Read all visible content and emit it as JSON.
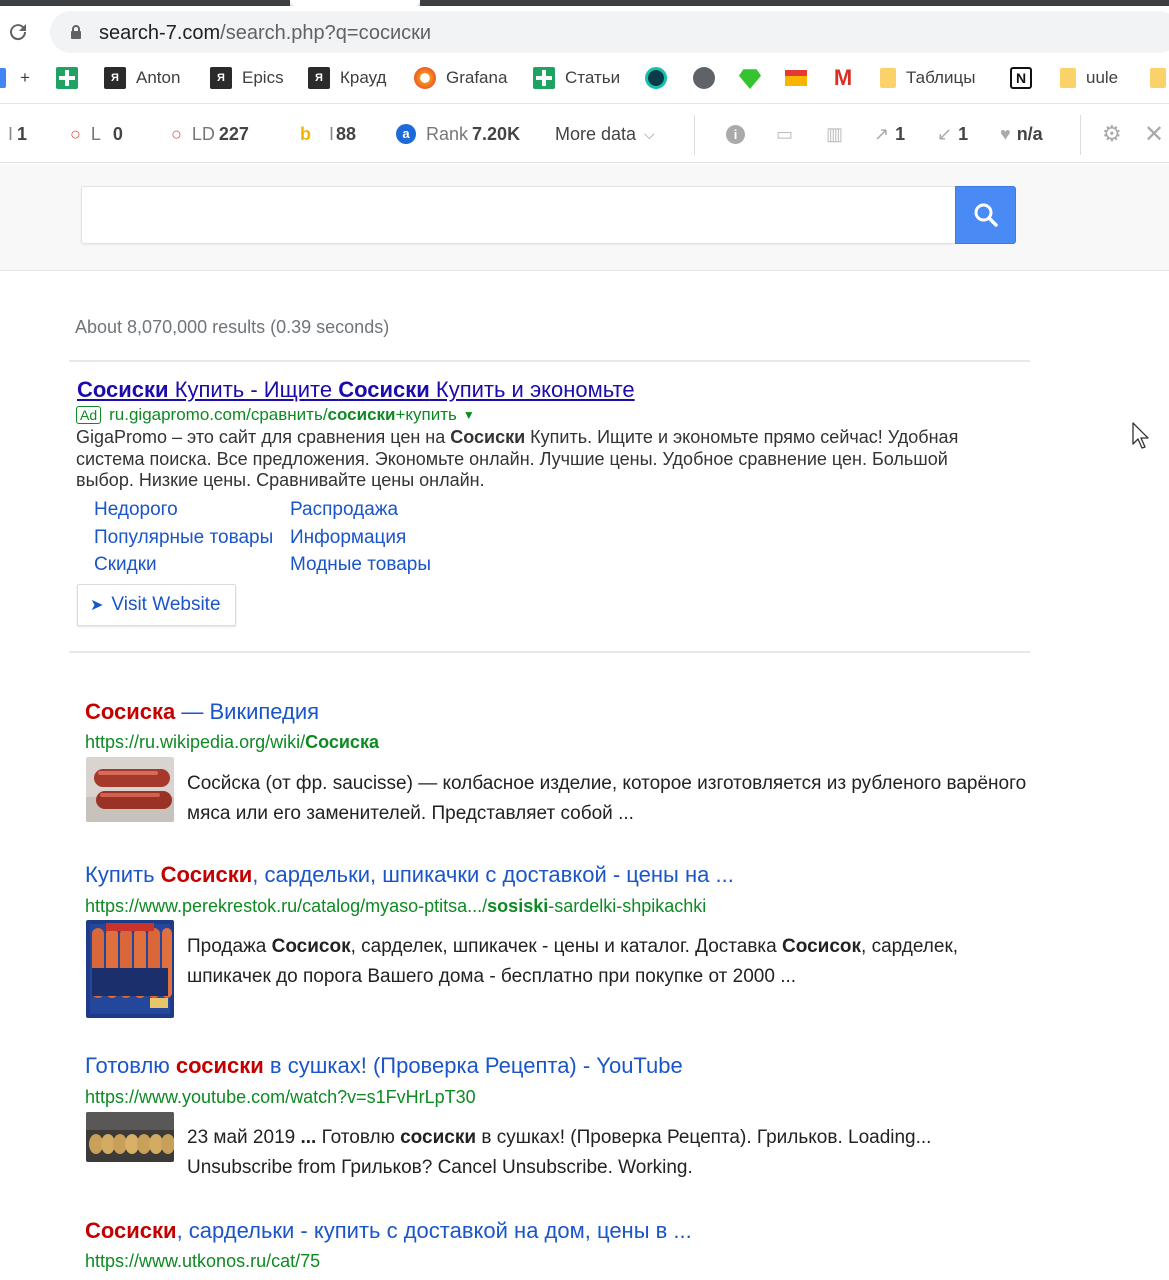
{
  "browser": {
    "url_host": "search-7.com",
    "url_path": "/search.php?q=сосиски"
  },
  "bookmarks": [
    {
      "icon": "plus-icon",
      "label": "+"
    },
    {
      "icon": "google-sheets-icon",
      "label": ""
    },
    {
      "icon": "yandex-ya-icon",
      "label": "Anton"
    },
    {
      "icon": "yandex-ya-icon",
      "label": "Epics"
    },
    {
      "icon": "yandex-ya-icon",
      "label": "Крауд"
    },
    {
      "icon": "grafana-icon",
      "label": "Grafana"
    },
    {
      "icon": "google-sheets-icon",
      "label": "Статьи"
    },
    {
      "icon": "globe-icon",
      "label": ""
    },
    {
      "icon": "sketch-gem-icon",
      "label": ""
    },
    {
      "icon": "mail-icon",
      "label": ""
    },
    {
      "icon": "gmail-icon",
      "label": ""
    },
    {
      "icon": "folder-icon",
      "label": "Таблицы"
    },
    {
      "icon": "notion-icon",
      "label": ""
    },
    {
      "icon": "folder-icon",
      "label": "uule"
    }
  ],
  "seo_bar": {
    "index": "1",
    "links_label": "L",
    "links_value": "0",
    "ld_label": "LD",
    "ld_value": "227",
    "bing_value": "88",
    "rank_label": "Rank",
    "rank_value": "7.20K",
    "more_data": "More data",
    "external_links": "1",
    "internal_links": "1",
    "health": "n/a"
  },
  "search": {
    "query_value": "",
    "stats": "About 8,070,000 results (0.39 seconds)"
  },
  "ad": {
    "title_hl1": "Сосиски",
    "title_mid1": " Купить - Ищите ",
    "title_hl2": "Сосиски",
    "title_mid2": " Купить и экономьте",
    "badge": "Ad",
    "url_pre": "ru.gigapromo.com/сравнить/",
    "url_hl": "сосиски",
    "url_post": "+купить",
    "desc_pre": "GigaPromo – это сайт для сравнения цен на ",
    "desc_hl": "Сосиски",
    "desc_post": " Купить. Ищите и экономьте прямо сейчас! Удобная система поиска. Все предложения. Экономьте онлайн. Лучшие цены. Удобное сравнение цен. Большой выбор. Низкие цены. Сравнивайте цены онлайн.",
    "sitelinks_left": [
      "Недорого",
      "Популярные товары",
      "Скидки"
    ],
    "sitelinks_right": [
      "Распродажа",
      "Информация",
      "Модные товары"
    ],
    "visit_label": "Visit Website"
  },
  "results": [
    {
      "title_hl": "Сосиска",
      "title_rest": " — Википедия",
      "url_pre": "https://ru.wikipedia.org/wiki/",
      "url_hl": "Сосиска",
      "url_post": "",
      "desc": "Сосйска (от фр. saucisse) — колбасное изделие, которое изготовляется из рубленого варёного мяса или его заменителей. Представляет собой ..."
    },
    {
      "title_pre": "Купить ",
      "title_hl": "Сосиски",
      "title_rest": ", сардельки, шпикачки с доставкой - цены на ...",
      "url_pre": "https://www.perekrestok.ru/catalog/myaso-ptitsa.../",
      "url_hl": "sosiski",
      "url_post": "-sardelki-shpikachki",
      "desc_a": "Продажа ",
      "desc_b": "Сосисок",
      "desc_c": ", сарделек, шпикачек - цены и каталог. Доставка ",
      "desc_d": "Сосисок",
      "desc_e": ", сарделек, шпикачек до порога Вашего дома - бесплатно при покупке от 2000  ..."
    },
    {
      "title_pre": "Готовлю ",
      "title_hl": "сосиски",
      "title_rest": " в сушках! (Проверка Рецепта) - YouTube",
      "url_pre": "https://www.youtube.com/watch?v=s1FvHrLpT30",
      "desc_a": "23 май 2019 ",
      "desc_b": "...",
      "desc_c": " Готовлю ",
      "desc_d": "сосиски",
      "desc_e": " в сушках! (Проверка Рецепта). Грильков. Loading... Unsubscribe from Грильков? Cancel Unsubscribe. Working."
    },
    {
      "title_hl": "Сосиски",
      "title_rest": ", сардельки - купить с доставкой на дом, цены в ...",
      "url_pre": "https://www.utkonos.ru/cat/75"
    }
  ],
  "colors": {
    "link": "#1a55c9",
    "highlight": "#c40000",
    "url_green": "#0d8a22",
    "search_button": "#4a8af4"
  }
}
